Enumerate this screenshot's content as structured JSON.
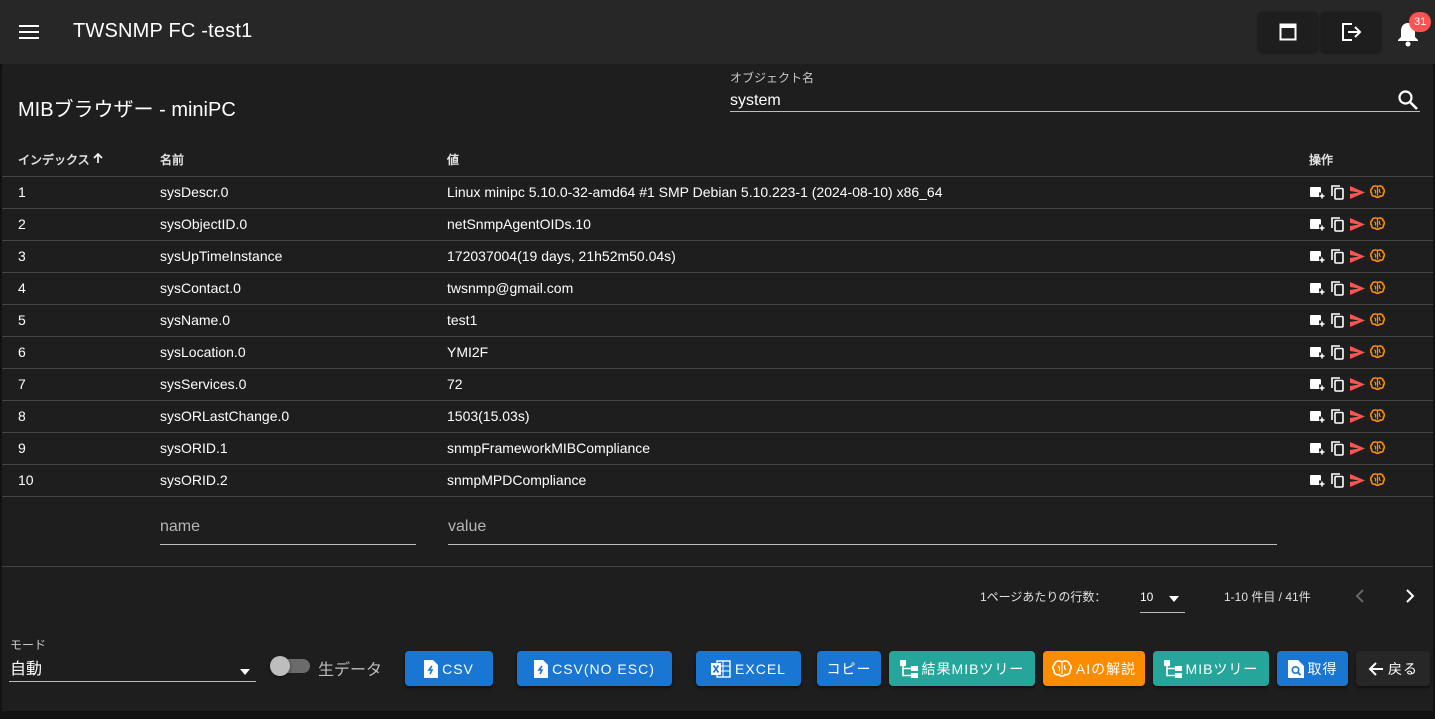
{
  "app": {
    "title": "TWSNMP FC -test1",
    "notification_count": "31"
  },
  "page": {
    "title": "MIBブラウザー - miniPC"
  },
  "search": {
    "label": "オブジェクト名",
    "value": "system"
  },
  "table": {
    "headers": {
      "index": "インデックス",
      "name": "名前",
      "value": "値",
      "ops": "操作"
    },
    "rows": [
      {
        "index": "1",
        "name": "sysDescr.0",
        "value": "Linux minipc 5.10.0-32-amd64 #1 SMP Debian 5.10.223-1 (2024-08-10) x86_64"
      },
      {
        "index": "2",
        "name": "sysObjectID.0",
        "value": "netSnmpAgentOIDs.10"
      },
      {
        "index": "3",
        "name": "sysUpTimeInstance",
        "value": "172037004(19 days, 21h52m50.04s)"
      },
      {
        "index": "4",
        "name": "sysContact.0",
        "value": "twsnmp@gmail.com"
      },
      {
        "index": "5",
        "name": "sysName.0",
        "value": "test1"
      },
      {
        "index": "6",
        "name": "sysLocation.0",
        "value": "YMI2F"
      },
      {
        "index": "7",
        "name": "sysServices.0",
        "value": "72"
      },
      {
        "index": "8",
        "name": "sysORLastChange.0",
        "value": "1503(15.03s)"
      },
      {
        "index": "9",
        "name": "sysORID.1",
        "value": "snmpFrameworkMIBCompliance"
      },
      {
        "index": "10",
        "name": "sysORID.2",
        "value": "snmpMPDCompliance"
      }
    ]
  },
  "filters": {
    "name_placeholder": "name",
    "value_placeholder": "value"
  },
  "pagination": {
    "rows_per_page_label": "1ページあたりの行数：",
    "rows_per_page": "10",
    "range": "1-10 件目 / 41件"
  },
  "mode": {
    "label": "モード",
    "value": "自動"
  },
  "raw_toggle": {
    "label": "生データ"
  },
  "buttons": {
    "csv": "CSV",
    "csv_no_esc": "CSV(NO ESC)",
    "excel": "EXCEL",
    "copy": "コピー",
    "result_mib_tree": "結果MIBツリー",
    "ai_explain": "AIの解説",
    "mib_tree": "MIBツリー",
    "get": "取得",
    "back": "戻る"
  },
  "colors": {
    "blue": "#1976d2",
    "teal": "#26a69a",
    "orange": "#fb8c00",
    "red": "#ff5252",
    "card": "#1e1e1e",
    "appbar": "#272727"
  }
}
